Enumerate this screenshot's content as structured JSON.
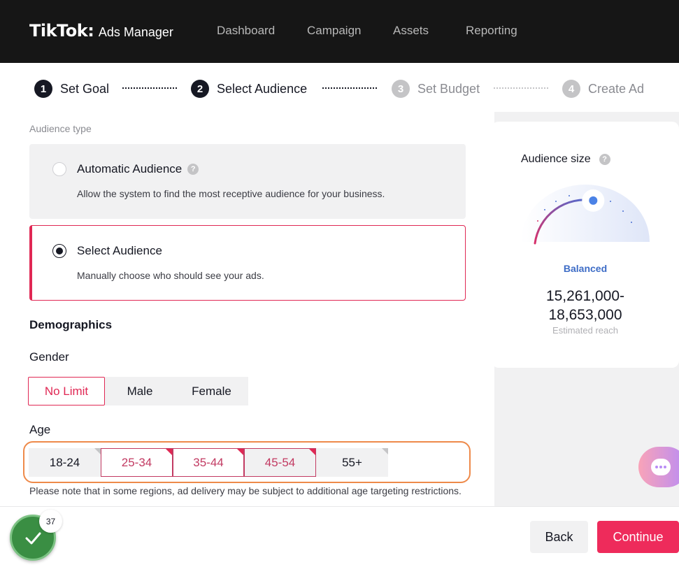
{
  "header": {
    "logo_main": "TikTok",
    "logo_colon": ":",
    "logo_sub": "Ads Manager",
    "nav": [
      "Dashboard",
      "Campaign",
      "Assets",
      "Reporting"
    ]
  },
  "steps": [
    {
      "num": "1",
      "label": "Set Goal"
    },
    {
      "num": "2",
      "label": "Select Audience"
    },
    {
      "num": "3",
      "label": "Set Budget"
    },
    {
      "num": "4",
      "label": "Create Ad"
    }
  ],
  "audience_type": {
    "label": "Audience type",
    "automatic": {
      "title": "Automatic Audience",
      "desc": "Allow the system to find the most receptive audience for your business.",
      "help": "?"
    },
    "select": {
      "title": "Select Audience",
      "desc": "Manually choose who should see your ads."
    }
  },
  "demographics": {
    "heading": "Demographics",
    "gender_label": "Gender",
    "gender_options": [
      "No Limit",
      "Male",
      "Female"
    ],
    "age_label": "Age",
    "age_options": [
      "18-24",
      "25-34",
      "35-44",
      "45-54",
      "55+"
    ],
    "note": "Please note that in some regions, ad delivery may be subject to additional age targeting restrictions."
  },
  "audience_size": {
    "title": "Audience size",
    "help": "?",
    "status": "Balanced",
    "reach_line1": "15,261,000-",
    "reach_line2": "18,653,000",
    "reach_label": "Estimated reach",
    "gauge_level": 0.55
  },
  "footer": {
    "back": "Back",
    "continue": "Continue",
    "badge_count": "37"
  },
  "colors": {
    "accent": "#ee2b5b",
    "balanced": "#3d6cc6"
  }
}
